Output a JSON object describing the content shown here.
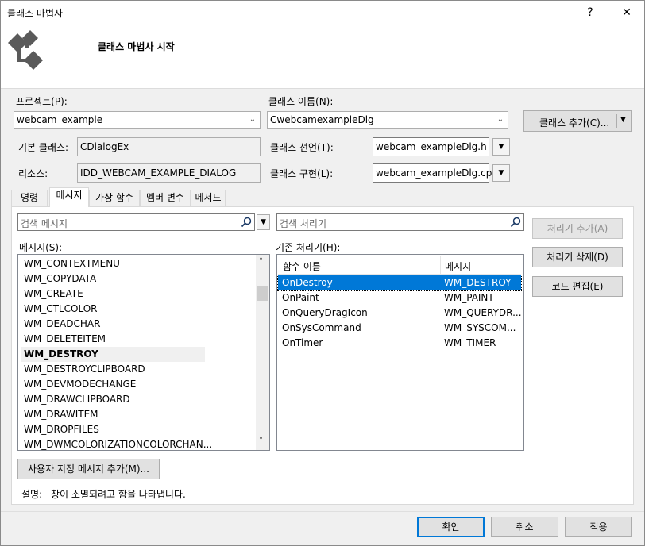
{
  "window": {
    "title": "클래스 마법사",
    "help_glyph": "?",
    "close_glyph": "✕"
  },
  "header": {
    "title": "클래스 마법사 시작",
    "logo_icon": "class-wizard-logo-icon"
  },
  "form": {
    "project_label": "프로젝트(P):",
    "project_value": "webcam_example",
    "class_name_label": "클래스 이름(N):",
    "class_name_value": "CwebcamexampleDlg",
    "add_class_label": "클래스 추가(C)...",
    "base_class_label": "기본 클래스:",
    "base_class_value": "CDialogEx",
    "class_decl_label": "클래스 선언(T):",
    "class_decl_value": "webcam_exampleDlg.h",
    "resource_label": "리소스:",
    "resource_value": "IDD_WEBCAM_EXAMPLE_DIALOG",
    "class_impl_label": "클래스 구현(L):",
    "class_impl_value": "webcam_exampleDlg.cpp"
  },
  "tabs": [
    "명령",
    "메시지",
    "가상 함수",
    "멤버 변수",
    "메서드"
  ],
  "active_tab": "메시지",
  "messages": {
    "search_placeholder": "검색 메시지",
    "list_label": "메시지(S):",
    "items": [
      "WM_CONTEXTMENU",
      "WM_COPYDATA",
      "WM_CREATE",
      "WM_CTLCOLOR",
      "WM_DEADCHAR",
      "WM_DELETEITEM",
      "WM_DESTROY",
      "WM_DESTROYCLIPBOARD",
      "WM_DEVMODECHANGE",
      "WM_DRAWCLIPBOARD",
      "WM_DRAWITEM",
      "WM_DROPFILES",
      "WM_DWMCOLORIZATIONCOLORCHAN..."
    ],
    "bold_item": "WM_DESTROY",
    "add_custom_label": "사용자 지정 메시지 추가(M)..."
  },
  "handlers": {
    "search_placeholder": "검색 처리기",
    "list_label": "기존 처리기(H):",
    "col_function": "함수 이름",
    "col_message": "메시지",
    "rows": [
      {
        "func": "OnDestroy",
        "msg": "WM_DESTROY"
      },
      {
        "func": "OnPaint",
        "msg": "WM_PAINT"
      },
      {
        "func": "OnQueryDragIcon",
        "msg": "WM_QUERYDR..."
      },
      {
        "func": "OnSysCommand",
        "msg": "WM_SYSCOM..."
      },
      {
        "func": "OnTimer",
        "msg": "WM_TIMER"
      }
    ],
    "selected": "OnDestroy"
  },
  "actions": {
    "add_handler": "처리기 추가(A)",
    "delete_handler": "처리기 삭제(D)",
    "edit_code": "코드 편집(E)"
  },
  "description": {
    "label": "설명:",
    "text": "창이 소멸되려고 함을 나타냅니다."
  },
  "footer": {
    "ok": "확인",
    "cancel": "취소",
    "apply": "적용"
  },
  "colors": {
    "selection": "#0078d7",
    "default_button_border": "#0078d7"
  }
}
